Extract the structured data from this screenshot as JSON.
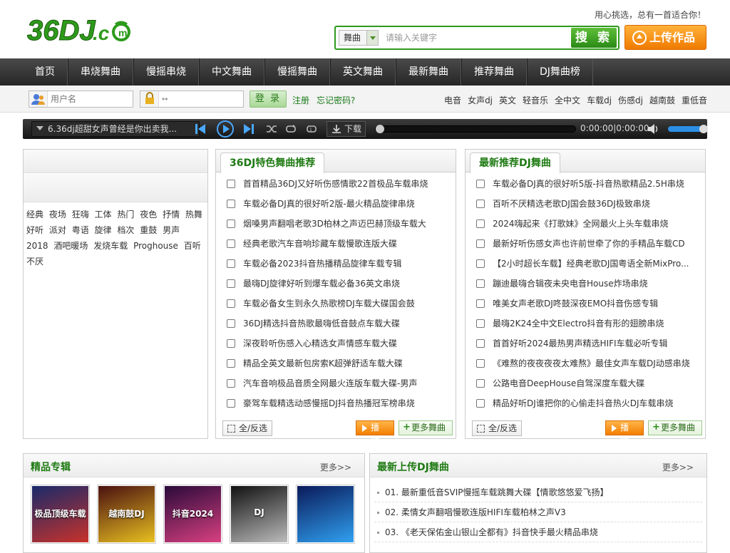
{
  "header": {
    "logo_text": "36DJ.cOm",
    "slogan": "用心挑选，总有一首适合你！",
    "search": {
      "category": "舞曲",
      "placeholder": "请输入关键字",
      "button": "搜 索"
    },
    "upload_button": "上传作品"
  },
  "nav": [
    "首页",
    "串烧舞曲",
    "慢摇串烧",
    "中文舞曲",
    "慢摇舞曲",
    "英文舞曲",
    "最新舞曲",
    "推荐舞曲",
    "DJ舞曲榜"
  ],
  "login": {
    "username_placeholder": "用户名",
    "password_value": "••",
    "login_button": "登 录",
    "register": "注册",
    "forgot": "忘记密码?"
  },
  "quick_tags": [
    "电音",
    "女声dj",
    "英文",
    "轻音乐",
    "全中文",
    "车载dj",
    "伤感dj",
    "越南鼓",
    "重低音"
  ],
  "player": {
    "current_track": "6.36dj超甜女声曾经是你出卖我...",
    "download": "下载",
    "time": "0:00:00|0:00:00",
    "progress": 0,
    "volume": 0.9
  },
  "left_tags": [
    "经典",
    "夜场",
    "狂嗨",
    "工体",
    "热门",
    "夜色",
    "抒情",
    "热舞",
    "好听",
    "派对",
    "粤语",
    "旋律",
    "档次",
    "重鼓",
    "男声",
    "2018",
    "酒吧暖场",
    "发烧车载",
    "Proghouse",
    "百听不厌"
  ],
  "featured": {
    "title": "36DJ特色舞曲推荐",
    "items": [
      "首首精品36DJ又好听伤感情歌22首极品车载串烧",
      "车载必备DJ真的很好听2版-最火精品旋律串烧",
      "烟嗓男声翻唱老歌3D柏林之声迈巴赫顶级车载大",
      "经典老歌汽车音响珍藏车载慢歌连版大碟",
      "车载必备2023抖音热播精品旋律车载专辑",
      "最嗨DJ旋律好听到爆车载必备36英文串烧",
      "车载必备女生到永久热歌榜DJ车载大碟国会鼓",
      "36DJ精选抖音热歌最嗨低音鼓点车载大碟",
      "深夜聆听伤感入心精选女声情感车载大碟",
      "精品全英文最新包房索K超弹舒适车载大碟",
      "汽车音响极品音质全网最火连版车载大碟-男声",
      "豪驾车载精选动感慢摇DJ抖音热播冠军榜串烧"
    ],
    "select_all": "全/反选",
    "play": "播 放",
    "more": "更多舞曲"
  },
  "latest": {
    "title": "最新推荐DJ舞曲",
    "items": [
      "车载必备DJ真的很好听5版-抖音热歌精品2.5H串烧",
      "百听不厌精选老歌DJ国会鼓36DJ极致串烧",
      "2024嗨起来《打歌妹》全网最火上头车载串烧",
      "最新好听伤感女声也许前世牵了你的手精品车载CD",
      "【2小时超长车载】经典老歌DJ国粤语全新MixPro...",
      "蹦迪最嗨合辑夜未央电音House炸场串烧",
      "唯美女声老歌DJ咚鼓深夜EMO抖音伤感专辑",
      "最嗨2K24全中文Electro抖音有形的翅膀串烧",
      "首首好听2024最热男声精选HIFI车载必听专辑",
      "《难熬的夜夜夜夜太难熬》最佳女声车载DJ动感串烧",
      "公路电音DeepHouse自驾深度车载大碟",
      "精品好听DJ谁把你的心偷走抖音热火DJ车载串烧"
    ],
    "select_all": "全/反选",
    "play": "播 放",
    "more": "更多舞曲"
  },
  "albums": {
    "title": "精品专辑",
    "more": "更多>>",
    "covers": [
      {
        "caption": "极品顶级车载",
        "colors": [
          "#1a2a6a",
          "#c8322a"
        ]
      },
      {
        "caption": "越南鼓DJ",
        "colors": [
          "#4a1010",
          "#e8c020"
        ]
      },
      {
        "caption": "抖音2024",
        "colors": [
          "#2a0a3a",
          "#d84080"
        ]
      },
      {
        "caption": "DJ",
        "colors": [
          "#111111",
          "#bbbbbb"
        ]
      },
      {
        "caption": "",
        "colors": [
          "#0a1a5a",
          "#30a0f0"
        ]
      }
    ]
  },
  "uploads": {
    "title": "最新上传DJ舞曲",
    "more": "更多>>",
    "items": [
      "01. 最新重低音SVIP慢摇车载跳舞大碟【情歌悠悠爱飞扬】",
      "02. 柔情女声翻唱慢歌连版HIFI车载柏林之声V3",
      "03. 《老天保佑金山银山全都有》抖音快手最火精品串烧"
    ]
  }
}
